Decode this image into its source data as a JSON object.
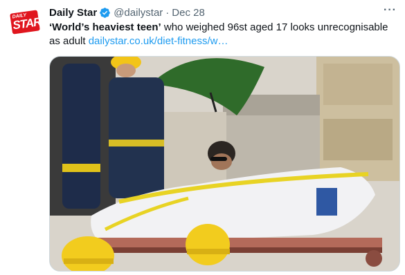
{
  "account": {
    "name": "Daily Star",
    "handle": "@dailystar",
    "separator": "·",
    "date": "Dec 28",
    "logo_top": "DAILY",
    "logo_main": "STAR"
  },
  "tweet": {
    "headline": "‘World’s heaviest teen’",
    "body": " who weighed 96st aged 17 looks unrecognisable as adult ",
    "link": "dailystar.co.uk/diet-fitness/w…"
  },
  "more_label": "···",
  "colors": {
    "link": "#1d9bf0",
    "verified": "#1d9bf0",
    "brand": "#e0161e",
    "muted": "#536471"
  },
  "icons": [
    "verified-badge-icon",
    "more-icon"
  ]
}
